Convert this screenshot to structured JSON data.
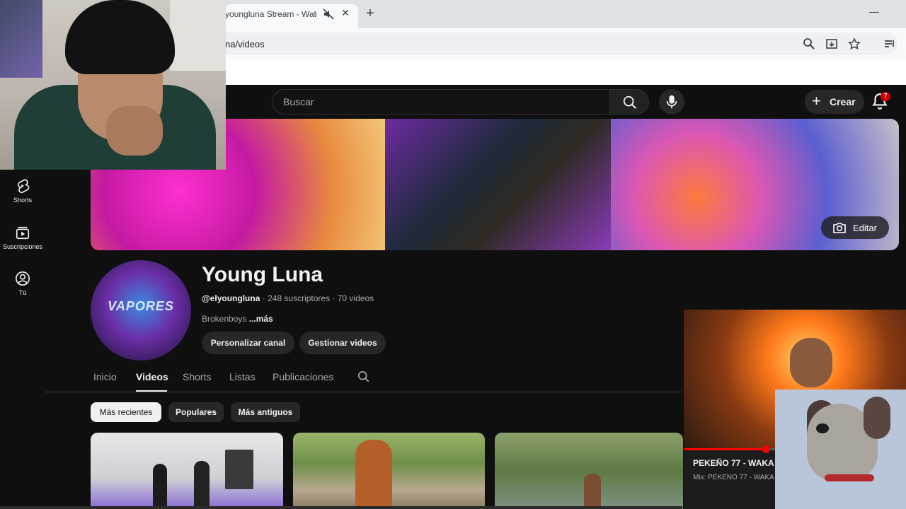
{
  "browser": {
    "tab_title": "youngluna Stream - Watc",
    "url": "na/videos"
  },
  "header": {
    "search_placeholder": "Buscar",
    "create_label": "Crear",
    "notifications_count": "7"
  },
  "sidebar": {
    "items": [
      {
        "label": "Shorts",
        "icon": "shorts-icon"
      },
      {
        "label": "Suscripciones",
        "icon": "subscriptions-icon"
      },
      {
        "label": "Tú",
        "icon": "you-icon"
      }
    ]
  },
  "banner": {
    "edit_label": "Editar"
  },
  "channel": {
    "name": "Young Luna",
    "handle": "@elyoungluna",
    "stats": " · 248 suscriptores · 70 videos",
    "description": "Brokenboys ",
    "more": "...más",
    "avatar_text": "VAPORES",
    "customize_label": "Personalizar canal",
    "manage_label": "Gestionar videos"
  },
  "tabs": [
    {
      "label": "Inicio"
    },
    {
      "label": "Videos"
    },
    {
      "label": "Shorts"
    },
    {
      "label": "Listas"
    },
    {
      "label": "Publicaciones"
    }
  ],
  "filters": [
    {
      "label": "Más recientes"
    },
    {
      "label": "Populares"
    },
    {
      "label": "Más antiguos"
    }
  ],
  "mini_player": {
    "title": "PEKEÑO 77 - WAKA W",
    "subtitle": "Mix: PEKEÑO 77 - WAKA",
    "progress": 0.37
  },
  "colors": {
    "background": "#0f0f0f",
    "accent_red": "#ff0000",
    "chip_active": "#f1f1f1"
  }
}
